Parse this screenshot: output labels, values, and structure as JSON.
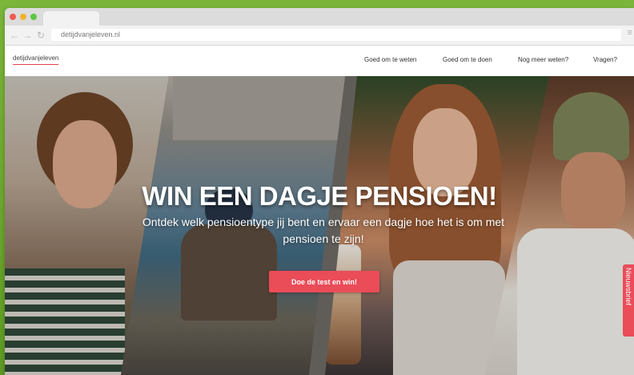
{
  "browser": {
    "back_icon": "arrow-left-icon",
    "forward_icon": "arrow-right-icon",
    "reload_icon": "reload-icon",
    "url": "detijdvanjeleven.nl",
    "menu_icon": "hamburger-menu-icon",
    "window_buttons": {
      "close": "#ee5a52",
      "minimize": "#f0b42c",
      "maximize": "#5cc642"
    }
  },
  "header": {
    "logo": "detijdvanjeleven",
    "nav": [
      "Goed om te weten",
      "Goed om te doen",
      "Nog meer weten?",
      "Vragen?"
    ]
  },
  "hero": {
    "title": "WIN EEN DAGJE PENSIOEN!",
    "subtitle": "Ontdek welk pensioentype jij bent en ervaar een dagje hoe het is om met pensioen te zijn!",
    "cta": "Doe de test en win!"
  },
  "side_tab": {
    "label": "Nieuwsbrief"
  },
  "colors": {
    "accent": "#ea4c58",
    "background": "#6aa32e"
  }
}
